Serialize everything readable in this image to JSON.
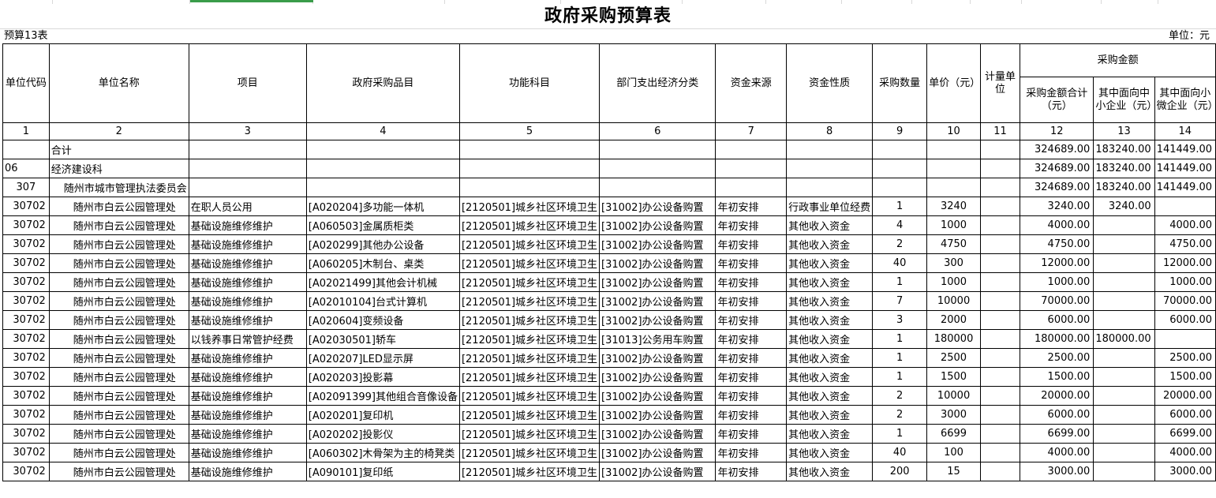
{
  "title": "政府采购预算表",
  "form_id": "预算13表",
  "unit_label": "单位：元",
  "headers": {
    "unit_code": "单位代码",
    "unit_name": "单位名称",
    "project": "项目",
    "procurement_item": "政府采购品目",
    "function_subject": "功能科目",
    "econ_class": "部门支出经济分类",
    "fund_source": "资金来源",
    "fund_nature": "资金性质",
    "quantity": "采购数量",
    "unit_price": "单价（元）",
    "measure_unit": "计量单位",
    "amount_group": "采购金额",
    "amount_total": "采购金额合计（元）",
    "amount_sme": "其中面向中小企业（元）",
    "amount_micro": "其中面向小微企业（元）"
  },
  "column_numbers": [
    "1",
    "2",
    "3",
    "4",
    "5",
    "6",
    "7",
    "8",
    "9",
    "10",
    "11",
    "12",
    "13",
    "14"
  ],
  "summary_rows": [
    {
      "code": "",
      "name": "合计",
      "total": "324689.00",
      "sme": "183240.00",
      "micro": "141449.00"
    },
    {
      "code": "06",
      "name": "经济建设科",
      "total": "324689.00",
      "sme": "183240.00",
      "micro": "141449.00"
    },
    {
      "code": "307",
      "name": "随州市城市管理执法委员会",
      "total": "324689.00",
      "sme": "183240.00",
      "micro": "141449.00"
    }
  ],
  "rows": [
    {
      "code": "30702",
      "name": "随州市白云公园管理处",
      "project": "在职人员公用",
      "item": "[A020204]多功能一体机",
      "func": "[2120501]城乡社区环境卫生",
      "econ": "[31002]办公设备购置",
      "source": "年初安排",
      "nature": "行政事业单位经费",
      "qty": "1",
      "price": "3240",
      "unit": "",
      "total": "3240.00",
      "sme": "3240.00",
      "micro": ""
    },
    {
      "code": "30702",
      "name": "随州市白云公园管理处",
      "project": "基础设施维修维护",
      "item": "[A060503]金属质柜类",
      "func": "[2120501]城乡社区环境卫生",
      "econ": "[31002]办公设备购置",
      "source": "年初安排",
      "nature": "其他收入资金",
      "qty": "4",
      "price": "1000",
      "unit": "",
      "total": "4000.00",
      "sme": "",
      "micro": "4000.00"
    },
    {
      "code": "30702",
      "name": "随州市白云公园管理处",
      "project": "基础设施维修维护",
      "item": "[A020299]其他办公设备",
      "func": "[2120501]城乡社区环境卫生",
      "econ": "[31002]办公设备购置",
      "source": "年初安排",
      "nature": "其他收入资金",
      "qty": "2",
      "price": "4750",
      "unit": "",
      "total": "4750.00",
      "sme": "",
      "micro": "4750.00"
    },
    {
      "code": "30702",
      "name": "随州市白云公园管理处",
      "project": "基础设施维修维护",
      "item": "[A060205]木制台、桌类",
      "func": "[2120501]城乡社区环境卫生",
      "econ": "[31002]办公设备购置",
      "source": "年初安排",
      "nature": "其他收入资金",
      "qty": "40",
      "price": "300",
      "unit": "",
      "total": "12000.00",
      "sme": "",
      "micro": "12000.00"
    },
    {
      "code": "30702",
      "name": "随州市白云公园管理处",
      "project": "基础设施维修维护",
      "item": "[A02021499]其他会计机械",
      "func": "[2120501]城乡社区环境卫生",
      "econ": "[31002]办公设备购置",
      "source": "年初安排",
      "nature": "其他收入资金",
      "qty": "1",
      "price": "1000",
      "unit": "",
      "total": "1000.00",
      "sme": "",
      "micro": "1000.00"
    },
    {
      "code": "30702",
      "name": "随州市白云公园管理处",
      "project": "基础设施维修维护",
      "item": "[A02010104]台式计算机",
      "func": "[2120501]城乡社区环境卫生",
      "econ": "[31002]办公设备购置",
      "source": "年初安排",
      "nature": "其他收入资金",
      "qty": "7",
      "price": "10000",
      "unit": "",
      "total": "70000.00",
      "sme": "",
      "micro": "70000.00"
    },
    {
      "code": "30702",
      "name": "随州市白云公园管理处",
      "project": "基础设施维修维护",
      "item": "[A020604]变频设备",
      "func": "[2120501]城乡社区环境卫生",
      "econ": "[31002]办公设备购置",
      "source": "年初安排",
      "nature": "其他收入资金",
      "qty": "3",
      "price": "2000",
      "unit": "",
      "total": "6000.00",
      "sme": "",
      "micro": "6000.00"
    },
    {
      "code": "30702",
      "name": "随州市白云公园管理处",
      "project": "以钱养事日常管护经费",
      "item": "[A02030501]轿车",
      "func": "[2120501]城乡社区环境卫生",
      "econ": "[31013]公务用车购置",
      "source": "年初安排",
      "nature": "其他收入资金",
      "qty": "1",
      "price": "180000",
      "unit": "",
      "total": "180000.00",
      "sme": "180000.00",
      "micro": ""
    },
    {
      "code": "30702",
      "name": "随州市白云公园管理处",
      "project": "基础设施维修维护",
      "item": "[A020207]LED显示屏",
      "func": "[2120501]城乡社区环境卫生",
      "econ": "[31002]办公设备购置",
      "source": "年初安排",
      "nature": "其他收入资金",
      "qty": "1",
      "price": "2500",
      "unit": "",
      "total": "2500.00",
      "sme": "",
      "micro": "2500.00"
    },
    {
      "code": "30702",
      "name": "随州市白云公园管理处",
      "project": "基础设施维修维护",
      "item": "[A020203]投影幕",
      "func": "[2120501]城乡社区环境卫生",
      "econ": "[31002]办公设备购置",
      "source": "年初安排",
      "nature": "其他收入资金",
      "qty": "1",
      "price": "1500",
      "unit": "",
      "total": "1500.00",
      "sme": "",
      "micro": "1500.00"
    },
    {
      "code": "30702",
      "name": "随州市白云公园管理处",
      "project": "基础设施维修维护",
      "item": "[A02091399]其他组合音像设备",
      "func": "[2120501]城乡社区环境卫生",
      "econ": "[31002]办公设备购置",
      "source": "年初安排",
      "nature": "其他收入资金",
      "qty": "2",
      "price": "10000",
      "unit": "",
      "total": "20000.00",
      "sme": "",
      "micro": "20000.00"
    },
    {
      "code": "30702",
      "name": "随州市白云公园管理处",
      "project": "基础设施维修维护",
      "item": "[A020201]复印机",
      "func": "[2120501]城乡社区环境卫生",
      "econ": "[31002]办公设备购置",
      "source": "年初安排",
      "nature": "其他收入资金",
      "qty": "2",
      "price": "3000",
      "unit": "",
      "total": "6000.00",
      "sme": "",
      "micro": "6000.00"
    },
    {
      "code": "30702",
      "name": "随州市白云公园管理处",
      "project": "基础设施维修维护",
      "item": "[A020202]投影仪",
      "func": "[2120501]城乡社区环境卫生",
      "econ": "[31002]办公设备购置",
      "source": "年初安排",
      "nature": "其他收入资金",
      "qty": "1",
      "price": "6699",
      "unit": "",
      "total": "6699.00",
      "sme": "",
      "micro": "6699.00"
    },
    {
      "code": "30702",
      "name": "随州市白云公园管理处",
      "project": "基础设施维修维护",
      "item": "[A060302]木骨架为主的椅凳类",
      "func": "[2120501]城乡社区环境卫生",
      "econ": "[31002]办公设备购置",
      "source": "年初安排",
      "nature": "其他收入资金",
      "qty": "40",
      "price": "100",
      "unit": "",
      "total": "4000.00",
      "sme": "",
      "micro": "4000.00"
    },
    {
      "code": "30702",
      "name": "随州市白云公园管理处",
      "project": "基础设施维修维护",
      "item": "[A090101]复印纸",
      "func": "[2120501]城乡社区环境卫生",
      "econ": "[31002]办公设备购置",
      "source": "年初安排",
      "nature": "其他收入资金",
      "qty": "200",
      "price": "15",
      "unit": "",
      "total": "3000.00",
      "sme": "",
      "micro": "3000.00"
    }
  ]
}
